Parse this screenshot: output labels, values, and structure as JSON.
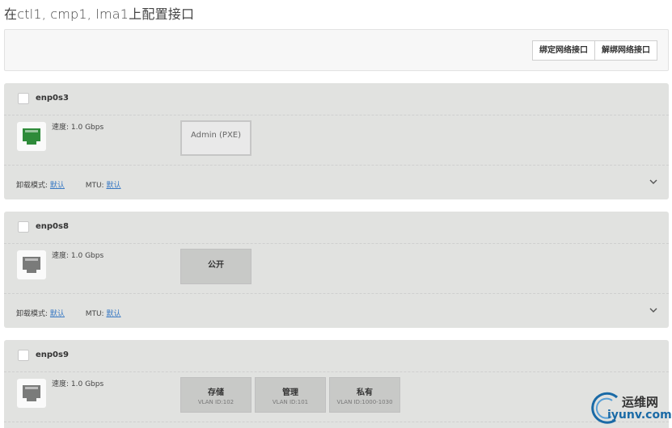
{
  "page": {
    "title": "在ctl1, cmp1, lma1上配置接口"
  },
  "toolbar": {
    "bond_label": "绑定网络接口",
    "unbond_label": "解绑网络接口"
  },
  "labels": {
    "speed_prefix": "速度: ",
    "offload_label": "卸载模式:",
    "mtu_label": "MTU:"
  },
  "interfaces": [
    {
      "name": "enp0s3",
      "speed": "1.0 Gbps",
      "status_color": "#2e8b3a",
      "offload_value": "默认",
      "mtu_value": "默认",
      "networks": [
        {
          "name": "Admin (PXE)"
        }
      ]
    },
    {
      "name": "enp0s8",
      "speed": "1.0 Gbps",
      "status_color": "#7a7b7a",
      "offload_value": "默认",
      "mtu_value": "默认",
      "networks": [
        {
          "name": "公开"
        }
      ]
    },
    {
      "name": "enp0s9",
      "speed": "1.0 Gbps",
      "status_color": "#7a7b7a",
      "networks": [
        {
          "name": "存储",
          "vlan": "VLAN ID:102"
        },
        {
          "name": "管理",
          "vlan": "VLAN ID:101"
        },
        {
          "name": "私有",
          "vlan": "VLAN ID:1000-1030"
        }
      ]
    }
  ],
  "watermark": {
    "text_cn": "运维网",
    "text_en": "iyunv.com",
    "color": "#1a6aa6"
  },
  "icons": {
    "expand": "chevron-down-icon",
    "port": "ethernet-port-icon"
  }
}
